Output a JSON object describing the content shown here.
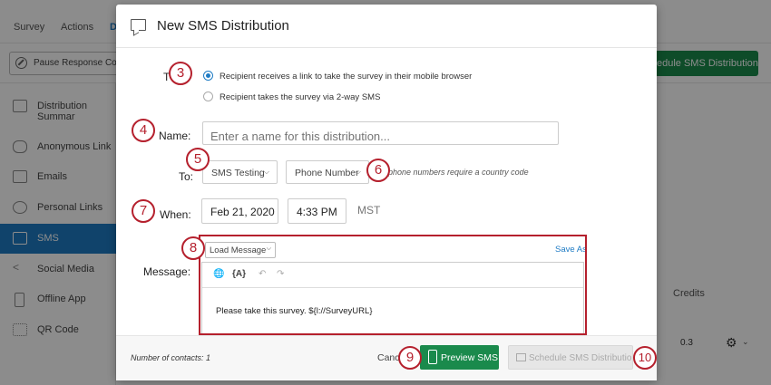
{
  "background": {
    "nav_tabs": [
      "Survey",
      "Actions",
      "D"
    ],
    "pause_button": "Pause Response Coll",
    "schedule_button": "edule SMS Distribution",
    "sidebar": [
      {
        "label": "Distribution Summar",
        "icon": "list-icon",
        "active": false
      },
      {
        "label": "Anonymous Link",
        "icon": "link-icon",
        "active": false
      },
      {
        "label": "Emails",
        "icon": "envelope-icon",
        "active": false
      },
      {
        "label": "Personal Links",
        "icon": "fingerprint-icon",
        "active": false
      },
      {
        "label": "SMS",
        "icon": "chat-icon",
        "active": true
      },
      {
        "label": "Social Media",
        "icon": "share-icon",
        "active": false
      },
      {
        "label": "Offline App",
        "icon": "tablet-icon",
        "active": false
      },
      {
        "label": "QR Code",
        "icon": "qr-code-icon",
        "active": false
      }
    ],
    "credits_label": "Credits",
    "credits_value": "0.3"
  },
  "modal": {
    "title": "New SMS Distribution",
    "type_label_partial": "T",
    "radio_options": [
      {
        "label": "Recipient receives a link to take the survey in their mobile browser",
        "selected": true
      },
      {
        "label": "Recipient takes the survey via 2-way SMS",
        "selected": false
      }
    ],
    "name_label": "Name:",
    "name_placeholder": "Enter a name for this distribution...",
    "to_label": "To:",
    "to_list": "SMS Testing",
    "to_field": "Phone Number",
    "to_hint": "phone numbers require a country code",
    "when_label": "When:",
    "when_date": "Feb 21, 2020",
    "when_time": "4:33 PM",
    "timezone": "MST",
    "message_label": "Message:",
    "load_message": "Load Message",
    "save_as": "Save As",
    "piped_text_btn": "{A}",
    "message_text": "Please take this survey. ${l://SurveyURL}",
    "contacts": "Number of contacts: 1",
    "cancel": "Cancel",
    "preview_button": "Preview SMS",
    "schedule_button": "Schedule SMS Distribution"
  },
  "callouts": [
    "3",
    "4",
    "5",
    "6",
    "7",
    "8",
    "9",
    "10"
  ],
  "colors": {
    "callout": "#b5202d",
    "primary_green": "#1a8a4c",
    "accent_blue": "#1e7bc4"
  }
}
